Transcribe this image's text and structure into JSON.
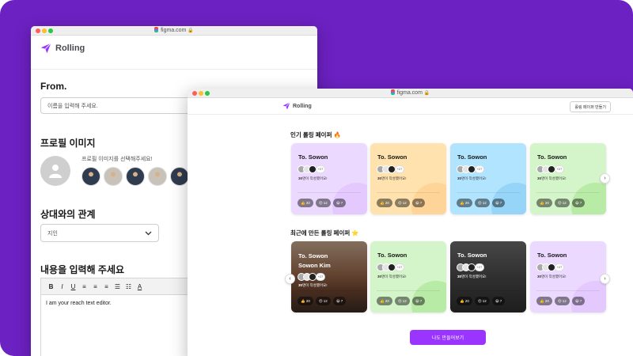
{
  "colors": {
    "background": "#6c21c2",
    "brand": "#9935ff"
  },
  "left_window": {
    "url": "figma.com",
    "logo": "Rolling",
    "from_label": "From.",
    "name_placeholder": "이름을 입력해 주세요.",
    "profile_title": "프로필 이미지",
    "profile_hint": "프로필 이미지를 선택해주세요!",
    "relation_title": "상대와의 관계",
    "relation_value": "지인",
    "content_title": "내용을 입력해 주세요",
    "toolbar": [
      "B",
      "I",
      "U",
      "≡",
      "≡",
      "≡",
      "☰",
      "☷",
      "A"
    ],
    "editor_text": "I am your reach text editor."
  },
  "right_window": {
    "url": "figma.com",
    "logo": "Rolling",
    "make_button": "롤링 페이퍼 만들기",
    "popular_title": "인기 롤링 페이퍼 🔥",
    "recent_title": "최근에 만든 롤링 페이퍼 ⭐️",
    "cta": "나도 만들어보기",
    "popular_cards": [
      {
        "to": "To. Sowon",
        "more": "+27",
        "count": "30",
        "count_suffix": "명이 작성했어요!",
        "reactions": [
          "👍 20",
          "😍 12",
          "😀 7"
        ]
      },
      {
        "to": "To. Sowon",
        "more": "+27",
        "count": "30",
        "count_suffix": "명이 작성했어요!",
        "reactions": [
          "👍 20",
          "😍 12",
          "😀 7"
        ]
      },
      {
        "to": "To. Sowon",
        "more": "+27",
        "count": "30",
        "count_suffix": "명이 작성했어요!",
        "reactions": [
          "👍 20",
          "😍 12",
          "😀 7"
        ]
      },
      {
        "to": "To. Sowon",
        "more": "+27",
        "count": "30",
        "count_suffix": "명이 작성했어요!",
        "reactions": [
          "👍 20",
          "😍 12",
          "😀 7"
        ]
      }
    ],
    "recent_cards": [
      {
        "to": "To. Sowon",
        "to2": "Sowon Kim",
        "more": "+27",
        "count": "30",
        "count_suffix": "명이 작성했어요!",
        "reactions": [
          "👍 20",
          "😍 12",
          "😀 7"
        ]
      },
      {
        "to": "To. Sowon",
        "more": "+27",
        "count": "30",
        "count_suffix": "명이 작성했어요!",
        "reactions": [
          "👍 20",
          "😍 12",
          "😀 7"
        ]
      },
      {
        "to": "To. Sowon",
        "more": "+27",
        "count": "30",
        "count_suffix": "명이 작성했어요!",
        "reactions": [
          "👍 20",
          "😍 12",
          "😀 7"
        ]
      },
      {
        "to": "To. Sowon",
        "more": "+27",
        "count": "30",
        "count_suffix": "명이 작성했어요!",
        "reactions": [
          "👍 20",
          "😍 12",
          "😀 7"
        ]
      }
    ]
  }
}
